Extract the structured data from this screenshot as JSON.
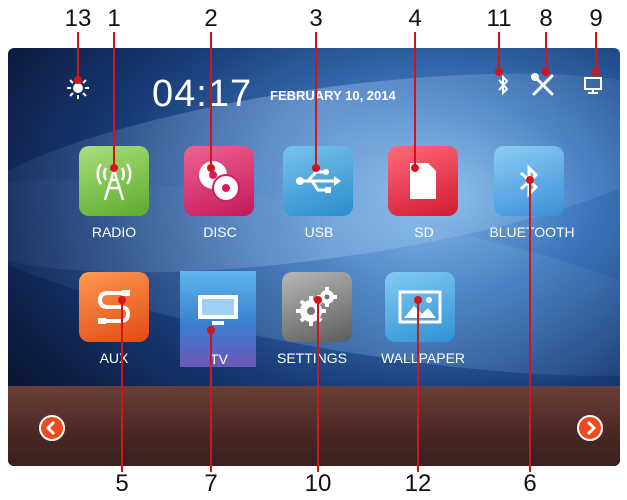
{
  "status_bar": {
    "time": "04:17",
    "date": "FEBRUARY 10, 2014",
    "brightness_icon": "sun-icon",
    "bluetooth_icon": "bluetooth-icon",
    "settings_icon": "tools-icon",
    "display_icon": "monitor-icon"
  },
  "apps": [
    {
      "label": "RADIO",
      "icon": "radio-tower-icon",
      "color": "#7bc742"
    },
    {
      "label": "DISC",
      "icon": "disc-icon",
      "color": "#e8336f"
    },
    {
      "label": "USB",
      "icon": "usb-icon",
      "color": "#4aa7d8"
    },
    {
      "label": "SD",
      "icon": "sd-card-icon",
      "color": "#e8213a"
    },
    {
      "label": "BLUETOOTH",
      "icon": "bluetooth-icon",
      "color": "#3b9ee8"
    },
    {
      "label": "AUX",
      "icon": "aux-cable-icon",
      "color": "#f26a25"
    },
    {
      "label": "TV",
      "icon": "tv-icon",
      "color": "#4da0e0"
    },
    {
      "label": "SETTINGS",
      "icon": "gear-icon",
      "color": "#8a8a8a"
    },
    {
      "label": "WALLPAPER",
      "icon": "picture-icon",
      "color": "#3fa5dc"
    }
  ],
  "navigation": {
    "prev_icon": "chevron-left-icon",
    "next_icon": "chevron-right-icon"
  },
  "callouts": {
    "top": [
      "13",
      "1",
      "2",
      "3",
      "4",
      "11",
      "8",
      "9"
    ],
    "bottom": [
      "5",
      "7",
      "10",
      "12",
      "6"
    ]
  },
  "colors": {
    "callout_line": "#d4141b",
    "nav_button": "#ef4a1c"
  }
}
